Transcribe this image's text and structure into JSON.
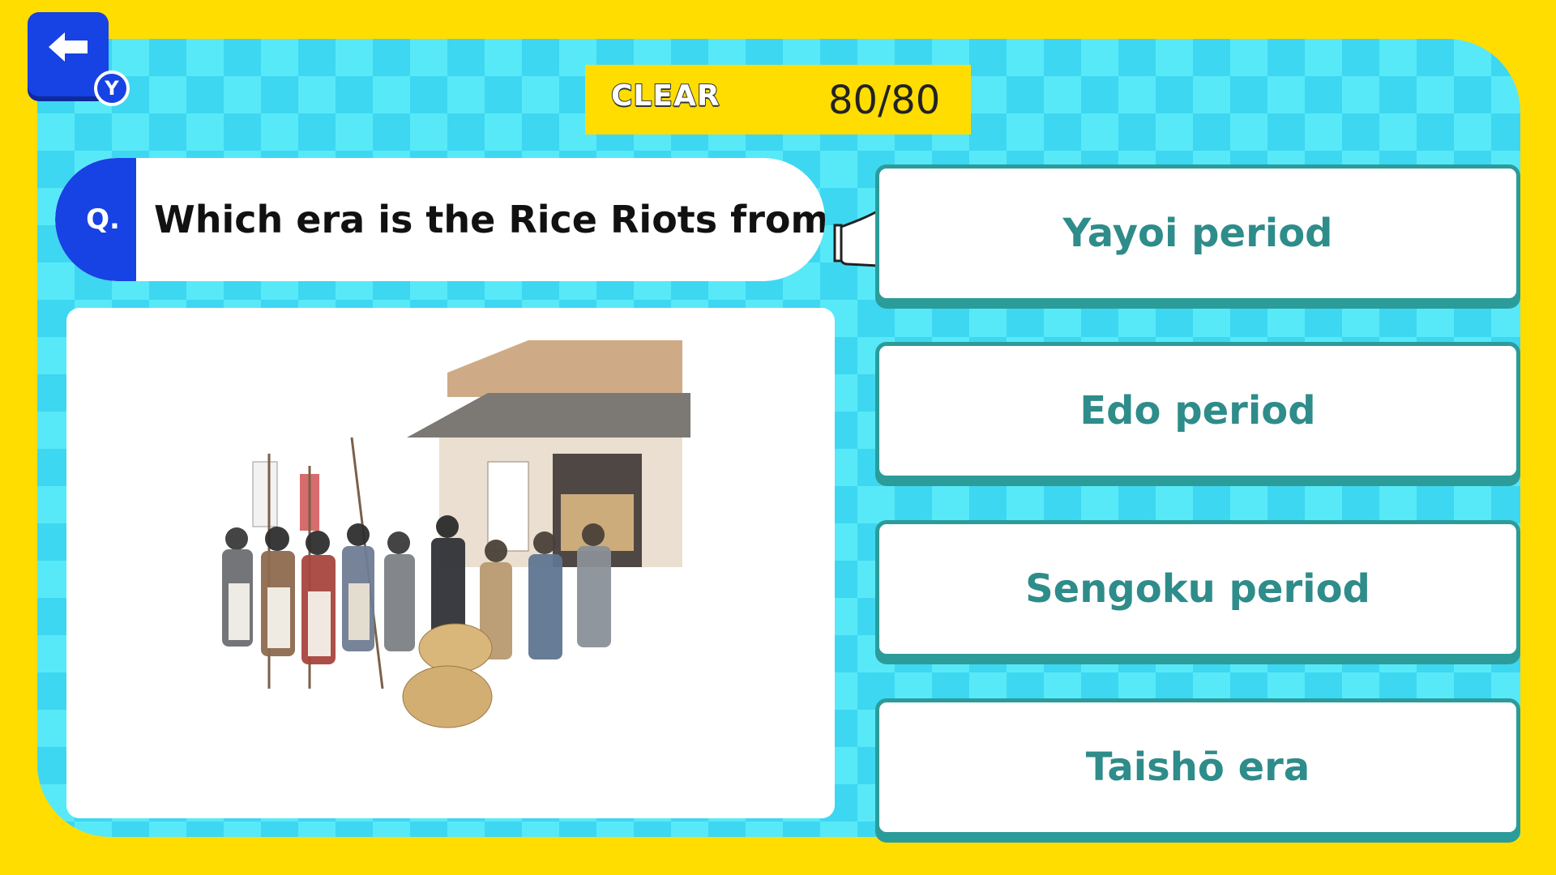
{
  "header": {
    "back_button_badge": "Y",
    "clear_label": "CLEAR",
    "score": "80/80"
  },
  "question": {
    "marker": "Q.",
    "text": "Which era is the Rice Riots from?"
  },
  "illustration": {
    "subject": "rice-riots-crowd-illustration"
  },
  "answers": [
    {
      "label": "Yayoi period"
    },
    {
      "label": "Edo period"
    },
    {
      "label": "Sengoku period"
    },
    {
      "label": "Taishō era"
    }
  ],
  "colors": {
    "frame_yellow": "#FFDD00",
    "panel_cyan": "#58E9F8",
    "accent_blue": "#1742E4",
    "answer_teal": "#2E8C8A"
  },
  "cursor": {
    "icon": "pointing-hand-icon",
    "selected_index": 0
  }
}
